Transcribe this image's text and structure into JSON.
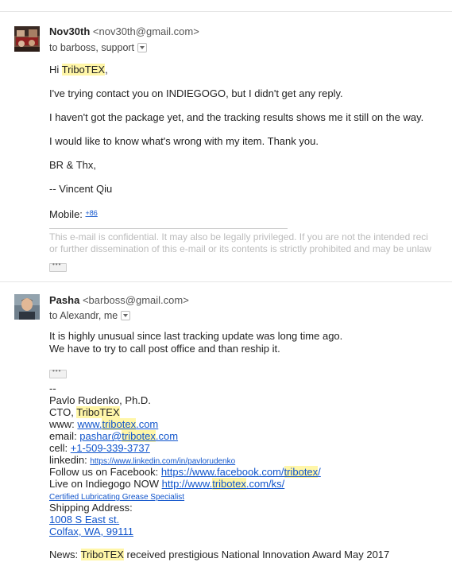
{
  "message1": {
    "sender_name": "Nov30th",
    "sender_email": "<nov30th@gmail.com>",
    "to_prefix": "to",
    "recipients": "barboss, support",
    "greeting_prefix": "Hi ",
    "greeting_name": "TriboTEX",
    "greeting_suffix": ",",
    "paragraphs": [
      "I've trying contact you on INDIEGOGO, but I didn't get any reply.",
      "I haven't got the package yet, and the tracking results shows me it still on the way.",
      "I would like to know what's wrong with my item. Thank you.",
      "BR & Thx,",
      "-- Vincent Qiu"
    ],
    "mobile_label": "Mobile: ",
    "mobile_value": "+86",
    "confidential_line1": "This e-mail is confidential. It may also be legally privileged. If you are not the intended reci",
    "confidential_line2": "or further dissemination of this e-mail or its contents is strictly prohibited and may be unlaw"
  },
  "message2": {
    "sender_name": "Pasha",
    "sender_email": "<barboss@gmail.com>",
    "to_prefix": "to",
    "recipients": "Alexandr, me",
    "body_lines": [
      "It is highly unusual since last tracking update was long time ago.",
      "We have to try to call post office and than reship it."
    ],
    "signature": {
      "dash": "--",
      "name": "Pavlo Rudenko, Ph.D.",
      "cto_prefix": "CTO, ",
      "company": "TriboTEX",
      "www_label": "www: ",
      "www_pre": "www.",
      "www_hl": "tribotex",
      "www_post": ".com",
      "email_label": "email: ",
      "email_pre": "pashar@",
      "email_hl": "tribotex",
      "email_post": ".com",
      "cell_label": "cell: ",
      "cell_value": "+1-509-339-3737",
      "linkedin_label": "linkedin: ",
      "linkedin_url": "https://www.linkedin.com/in/pavlorudenko",
      "facebook_label": "Follow us on Facebook: ",
      "facebook_pre": "https://www.facebook.com/",
      "facebook_hl": "tribotex",
      "facebook_post": "/",
      "indiegogo_label": "Live on Indiegogo NOW ",
      "indiegogo_pre": "http://www.",
      "indiegogo_hl": "tribotex",
      "indiegogo_post": ".com/ks/",
      "specialist": "Certified Lubricating Grease Specialist",
      "shipping_label": "Shipping Address:",
      "address_line1": "1008 S East st.",
      "address_line2": "Colfax, WA, 99111",
      "news_prefix": "News: ",
      "news_company": "TriboTEX",
      "news_suffix": " received prestigious National Innovation Award May 2017"
    }
  }
}
